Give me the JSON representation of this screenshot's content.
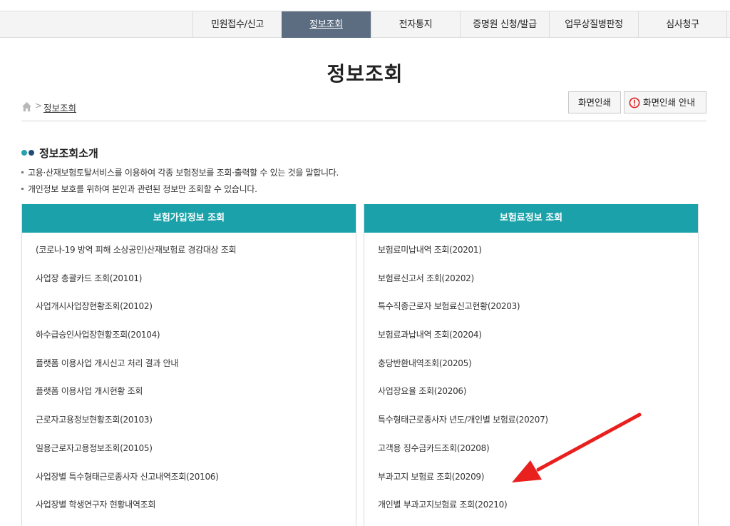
{
  "nav": {
    "items": [
      "민원접수/신고",
      "정보조회",
      "전자통지",
      "증명원 신청/발급",
      "업무상질병판정",
      "심사청구"
    ],
    "active_index": 1
  },
  "page": {
    "title": "정보조회"
  },
  "breadcrumb": {
    "separator": ">",
    "current": "정보조회"
  },
  "toolbar": {
    "print_label": "화면인쇄",
    "print_guide_label": "화면인쇄 안내"
  },
  "intro": {
    "heading": "정보조회소개",
    "lines": [
      "고용·산재보험토탈서비스를 이용하여 각종 보험정보를 조회·출력할 수 있는 것을 말합니다.",
      "개인정보 보호를 위하여 본인과 관련된 정보만 조회할 수 있습니다."
    ]
  },
  "panels": {
    "left": {
      "title": "보험가입정보 조회",
      "items": [
        "(코로나-19 방역 피해 소상공인)산재보험료 경감대상 조회",
        "사업장 총괄카드 조회(20101)",
        "사업개시사업장현황조회(20102)",
        "하수급승인사업장현황조회(20104)",
        "플랫폼 이용사업 개시신고 처리 결과 안내",
        "플랫폼 이용사업 개시현황 조회",
        "근로자고용정보현황조회(20103)",
        "일용근로자고용정보조회(20105)",
        "사업장별 특수형태근로종사자 신고내역조회(20106)",
        "사업장별 학생연구자 현황내역조회"
      ]
    },
    "right": {
      "title": "보험료정보 조회",
      "items": [
        "보험료미납내역 조회(20201)",
        "보험료신고서 조회(20202)",
        "특수직종근로자 보험료신고현황(20203)",
        "보험료과납내역 조회(20204)",
        "충당반환내역조회(20205)",
        "사업장요율 조회(20206)",
        "특수형태근로종사자 년도/개인별 보험료(20207)",
        "고객용 징수금카드조회(20208)",
        "부과고지 보험료 조회(20209)",
        "개인별 부과고지보험료 조회(20210)"
      ]
    }
  },
  "colors": {
    "nav_active": "#5c6d82",
    "panel_header": "#1aa1a9",
    "annotation_arrow": "#e8201e",
    "alert_icon": "#e02020"
  },
  "icons": {
    "home": "home-icon",
    "alert": "alert-icon",
    "annotation": "arrow-icon"
  }
}
